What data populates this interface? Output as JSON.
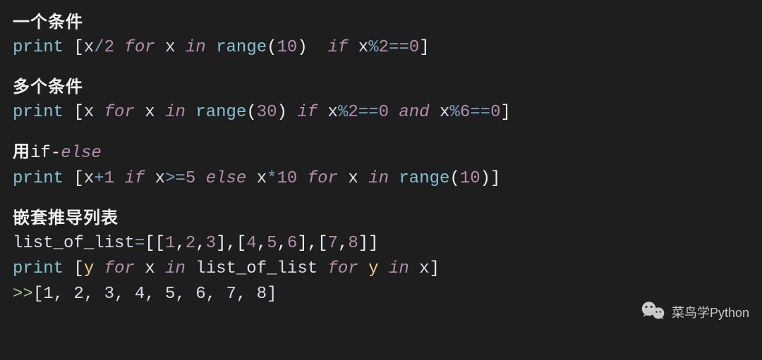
{
  "sections": [
    {
      "heading": "一个条件",
      "heading_kw": "",
      "heading_kw_italic": "",
      "lines": [
        [
          {
            "t": "print ",
            "c": "t-func"
          },
          {
            "t": "[",
            "c": "t-brack"
          },
          {
            "t": "x",
            "c": "t-var"
          },
          {
            "t": "/",
            "c": "t-op"
          },
          {
            "t": "2",
            "c": "t-num"
          },
          {
            "t": " ",
            "c": "t-white"
          },
          {
            "t": "for",
            "c": "t-keyword"
          },
          {
            "t": " x ",
            "c": "t-var"
          },
          {
            "t": "in",
            "c": "t-keyword"
          },
          {
            "t": " ",
            "c": "t-white"
          },
          {
            "t": "range",
            "c": "t-func"
          },
          {
            "t": "(",
            "c": "t-paren"
          },
          {
            "t": "10",
            "c": "t-num"
          },
          {
            "t": ")",
            "c": "t-paren"
          },
          {
            "t": "  ",
            "c": "t-white"
          },
          {
            "t": "if",
            "c": "t-keyword"
          },
          {
            "t": " x",
            "c": "t-var"
          },
          {
            "t": "%",
            "c": "t-op"
          },
          {
            "t": "2",
            "c": "t-num"
          },
          {
            "t": "==",
            "c": "t-op"
          },
          {
            "t": "0",
            "c": "t-num"
          },
          {
            "t": "]",
            "c": "t-brack"
          }
        ]
      ]
    },
    {
      "heading": "多个条件",
      "heading_kw": "",
      "heading_kw_italic": "",
      "lines": [
        [
          {
            "t": "print ",
            "c": "t-func"
          },
          {
            "t": "[",
            "c": "t-brack"
          },
          {
            "t": "x",
            "c": "t-var"
          },
          {
            "t": " ",
            "c": "t-white"
          },
          {
            "t": "for",
            "c": "t-keyword"
          },
          {
            "t": " x ",
            "c": "t-var"
          },
          {
            "t": "in",
            "c": "t-keyword"
          },
          {
            "t": " ",
            "c": "t-white"
          },
          {
            "t": "range",
            "c": "t-func"
          },
          {
            "t": "(",
            "c": "t-paren"
          },
          {
            "t": "30",
            "c": "t-num"
          },
          {
            "t": ")",
            "c": "t-paren"
          },
          {
            "t": " ",
            "c": "t-white"
          },
          {
            "t": "if",
            "c": "t-keyword"
          },
          {
            "t": " x",
            "c": "t-var"
          },
          {
            "t": "%",
            "c": "t-op"
          },
          {
            "t": "2",
            "c": "t-num"
          },
          {
            "t": "==",
            "c": "t-op"
          },
          {
            "t": "0",
            "c": "t-num"
          },
          {
            "t": " ",
            "c": "t-white"
          },
          {
            "t": "and",
            "c": "t-keyword"
          },
          {
            "t": " x",
            "c": "t-var"
          },
          {
            "t": "%",
            "c": "t-op"
          },
          {
            "t": "6",
            "c": "t-num"
          },
          {
            "t": "==",
            "c": "t-op"
          },
          {
            "t": "0",
            "c": "t-num"
          },
          {
            "t": "]",
            "c": "t-brack"
          }
        ]
      ]
    },
    {
      "heading": "用",
      "heading_kw": "if-",
      "heading_kw_italic": "else",
      "lines": [
        [
          {
            "t": "print ",
            "c": "t-func"
          },
          {
            "t": "[",
            "c": "t-brack"
          },
          {
            "t": "x",
            "c": "t-var"
          },
          {
            "t": "+",
            "c": "t-op"
          },
          {
            "t": "1",
            "c": "t-num"
          },
          {
            "t": " ",
            "c": "t-white"
          },
          {
            "t": "if",
            "c": "t-keyword"
          },
          {
            "t": " x",
            "c": "t-var"
          },
          {
            "t": ">=",
            "c": "t-op"
          },
          {
            "t": "5",
            "c": "t-num"
          },
          {
            "t": " ",
            "c": "t-white"
          },
          {
            "t": "else",
            "c": "t-keyword"
          },
          {
            "t": " x",
            "c": "t-var"
          },
          {
            "t": "*",
            "c": "t-op"
          },
          {
            "t": "10",
            "c": "t-num"
          },
          {
            "t": " ",
            "c": "t-white"
          },
          {
            "t": "for",
            "c": "t-keyword"
          },
          {
            "t": " x ",
            "c": "t-var"
          },
          {
            "t": "in",
            "c": "t-keyword"
          },
          {
            "t": " ",
            "c": "t-white"
          },
          {
            "t": "range",
            "c": "t-func"
          },
          {
            "t": "(",
            "c": "t-paren"
          },
          {
            "t": "10",
            "c": "t-num"
          },
          {
            "t": ")",
            "c": "t-paren"
          },
          {
            "t": "]",
            "c": "t-brack"
          }
        ]
      ]
    },
    {
      "heading": "嵌套推导列表",
      "heading_kw": "",
      "heading_kw_italic": "",
      "lines": [
        [
          {
            "t": "list_of_list",
            "c": "t-var"
          },
          {
            "t": "=",
            "c": "t-op"
          },
          {
            "t": "[[",
            "c": "t-brack"
          },
          {
            "t": "1",
            "c": "t-num"
          },
          {
            "t": ",",
            "c": "t-white"
          },
          {
            "t": "2",
            "c": "t-num"
          },
          {
            "t": ",",
            "c": "t-white"
          },
          {
            "t": "3",
            "c": "t-num"
          },
          {
            "t": "],[",
            "c": "t-brack"
          },
          {
            "t": "4",
            "c": "t-num"
          },
          {
            "t": ",",
            "c": "t-white"
          },
          {
            "t": "5",
            "c": "t-num"
          },
          {
            "t": ",",
            "c": "t-white"
          },
          {
            "t": "6",
            "c": "t-num"
          },
          {
            "t": "],[",
            "c": "t-brack"
          },
          {
            "t": "7",
            "c": "t-num"
          },
          {
            "t": ",",
            "c": "t-white"
          },
          {
            "t": "8",
            "c": "t-num"
          },
          {
            "t": "]]",
            "c": "t-brack"
          }
        ],
        [
          {
            "t": "print ",
            "c": "t-func"
          },
          {
            "t": "[",
            "c": "t-brack"
          },
          {
            "t": "y",
            "c": "t-yellow"
          },
          {
            "t": " ",
            "c": "t-white"
          },
          {
            "t": "for",
            "c": "t-keyword"
          },
          {
            "t": " x ",
            "c": "t-var"
          },
          {
            "t": "in",
            "c": "t-keyword"
          },
          {
            "t": " list_of_list ",
            "c": "t-var"
          },
          {
            "t": "for",
            "c": "t-keyword"
          },
          {
            "t": " y ",
            "c": "t-yellow"
          },
          {
            "t": "in",
            "c": "t-keyword"
          },
          {
            "t": " x",
            "c": "t-var"
          },
          {
            "t": "]",
            "c": "t-brack"
          }
        ],
        [
          {
            "t": ">>",
            "c": "t-prompt"
          },
          {
            "t": "[1, 2, 3, 4, 5, 6, 7, 8]",
            "c": "t-out"
          }
        ]
      ]
    }
  ],
  "watermark": "菜鸟学Python"
}
